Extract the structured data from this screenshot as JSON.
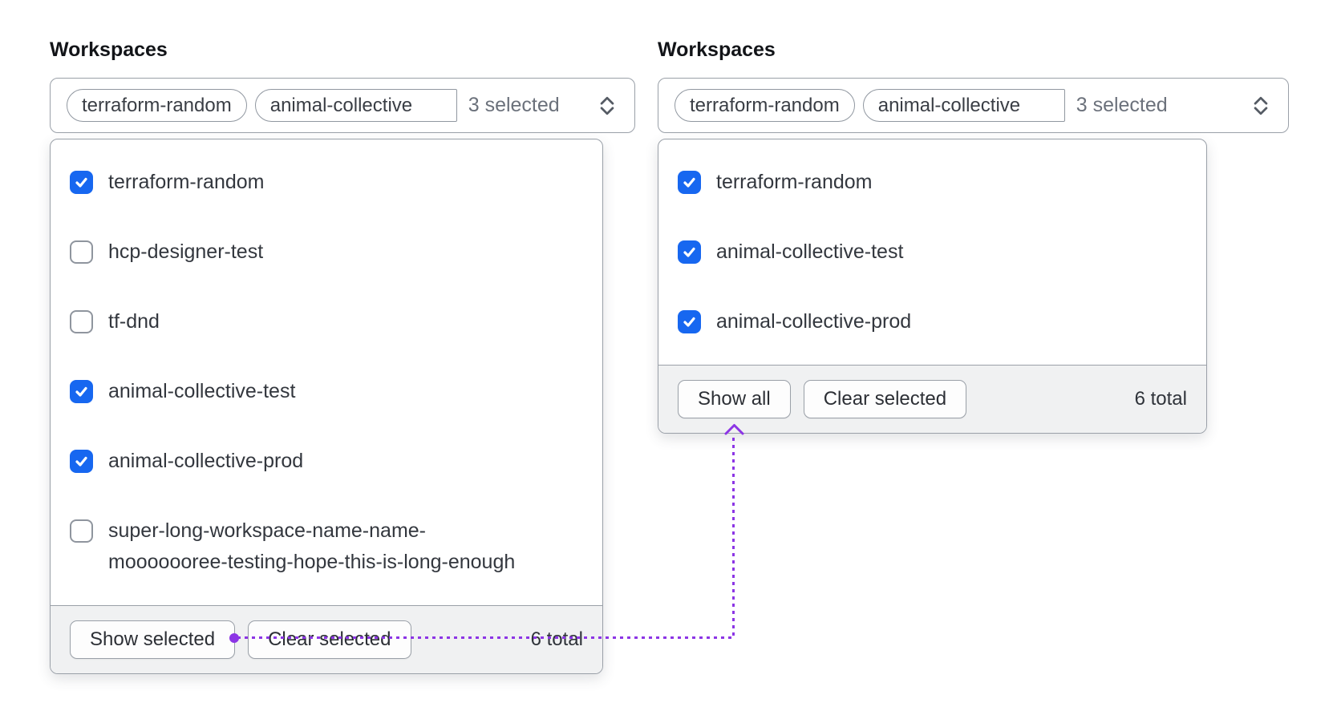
{
  "colors": {
    "checkbox_blue": "#1767f0",
    "annotation_purple": "#8c35e5",
    "border_gray": "#9aa0a8",
    "footer_background": "#f0f1f2"
  },
  "icons": {
    "select_chevron": "chevron-up-down",
    "checkbox_check": "check",
    "annotation_arrow": "arrow-up"
  },
  "panels": [
    {
      "label": "Workspaces",
      "select": {
        "tags": [
          "terraform-random",
          "animal-collective"
        ],
        "summary": "3 selected"
      },
      "options": [
        {
          "label": "terraform-random",
          "checked": true
        },
        {
          "label": "hcp-designer-test",
          "checked": false
        },
        {
          "label": "tf-dnd",
          "checked": false
        },
        {
          "label": "animal-collective-test",
          "checked": true
        },
        {
          "label": "animal-collective-prod",
          "checked": true
        },
        {
          "label": "super-long-workspace-name-name-\nmooooooree-testing-hope-this-is-long-enough",
          "checked": false
        }
      ],
      "footer": {
        "show_button": "Show selected",
        "clear_button": "Clear selected",
        "total": "6 total"
      }
    },
    {
      "label": "Workspaces",
      "select": {
        "tags": [
          "terraform-random",
          "animal-collective"
        ],
        "summary": "3 selected"
      },
      "options": [
        {
          "label": "terraform-random",
          "checked": true
        },
        {
          "label": "animal-collective-test",
          "checked": true
        },
        {
          "label": "animal-collective-prod",
          "checked": true
        }
      ],
      "footer": {
        "show_button": "Show all",
        "clear_button": "Clear selected",
        "total": "6 total"
      }
    }
  ]
}
